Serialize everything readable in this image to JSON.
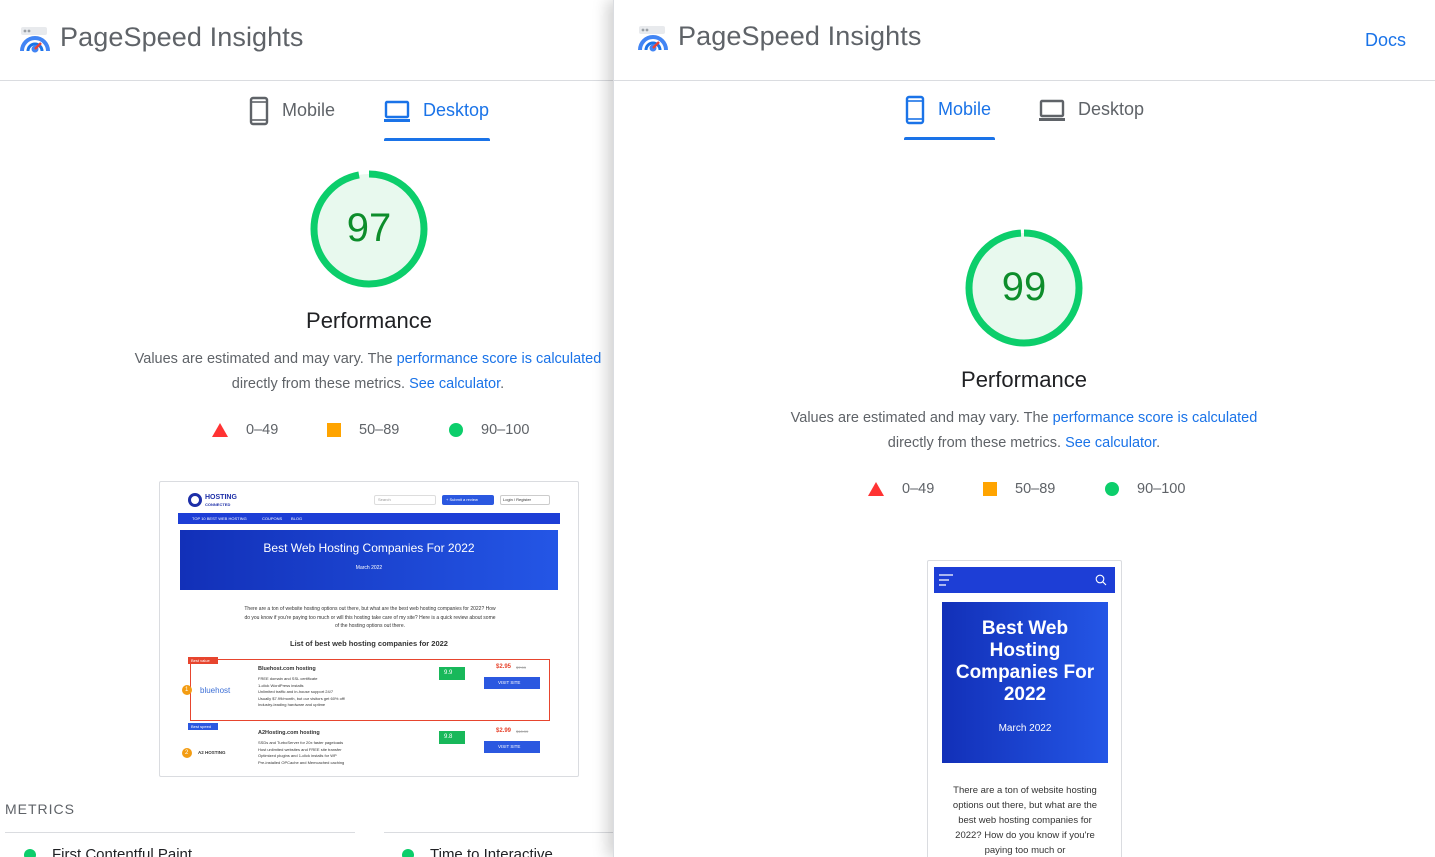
{
  "left": {
    "header": {
      "title": "PageSpeed Insights"
    },
    "tabs": [
      {
        "label": "Mobile",
        "active": false
      },
      {
        "label": "Desktop",
        "active": true
      }
    ],
    "score": {
      "value": "97",
      "fraction": 0.97
    },
    "category_title": "Performance",
    "description": {
      "text1": "Values are estimated and may vary. The ",
      "link1": "performance score is calculated",
      "text2": "directly from these metrics. ",
      "link2": "See calculator",
      "text3": "."
    },
    "legend": [
      {
        "range": "0–49",
        "shape": "triangle",
        "color": "#ff3333"
      },
      {
        "range": "50–89",
        "shape": "square",
        "color": "#ffa400"
      },
      {
        "range": "90–100",
        "shape": "circle",
        "color": "#0cce6b"
      }
    ],
    "screenshot": {
      "brand": "HOSTING",
      "brand_sub": "CONNECTED",
      "search_placeholder": "Search",
      "submit_btn": "+ Submit a review",
      "login_btn": "Login / Register",
      "nav": [
        "TOP 10 BEST WEB HOSTING",
        "COUPONS",
        "BLOG"
      ],
      "hero_title": "Best Web Hosting Companies For 2022",
      "hero_date": "March 2022",
      "intro": "There are a ton of website hosting options out there, but what are the best web hosting companies for 2022? How do you know if you're paying too much or will this hosting take care of my site? Here is a quick review about some of the hosting options out there.",
      "list_title": "List of best web hosting companies for 2022",
      "entries": [
        {
          "rank": "1",
          "badge": "Best value",
          "logo": "bluehost",
          "name": "Bluehost.com hosting",
          "rating": "9.9",
          "price": "$2.95",
          "old_price": "$7.99",
          "button": "VISIT SITE",
          "features": [
            "FREE domain and SSL certificate",
            "1-click WordPress installs",
            "Unlimited traffic and in-house support 24/7",
            "Usually $7.99/month, but our visitors get 60% off!",
            "Industry-leading hardware and uptime"
          ]
        },
        {
          "rank": "2",
          "badge": "Best speed",
          "logo": "A2 HOSTING",
          "name": "A2Hosting.com hosting",
          "rating": "9.8",
          "price": "$2.99",
          "old_price": "$10.99",
          "button": "VISIT SITE",
          "features": [
            "SSDs and TurboServer for 20x faster pageloads",
            "Host unlimited websites and FREE site transfer",
            "Optimized plugins and 1-click installs for WP",
            "Pre-installed OPCache and Memcached caching"
          ]
        }
      ]
    },
    "metrics": {
      "title": "METRICS",
      "items": [
        "First Contentful Paint",
        "Time to Interactive"
      ]
    }
  },
  "right": {
    "header": {
      "title": "PageSpeed Insights",
      "docs": "Docs"
    },
    "tabs": [
      {
        "label": "Mobile",
        "active": true
      },
      {
        "label": "Desktop",
        "active": false
      }
    ],
    "score": {
      "value": "99",
      "fraction": 0.99
    },
    "category_title": "Performance",
    "description": {
      "text1": "Values are estimated and may vary. The ",
      "link1": "performance score is calculated",
      "text2": "directly from these metrics. ",
      "link2": "See calculator",
      "text3": "."
    },
    "legend": [
      {
        "range": "0–49",
        "shape": "triangle",
        "color": "#ff3333"
      },
      {
        "range": "50–89",
        "shape": "square",
        "color": "#ffa400"
      },
      {
        "range": "90–100",
        "shape": "circle",
        "color": "#0cce6b"
      }
    ],
    "screenshot": {
      "hero_title": "Best Web Hosting Companies For 2022",
      "hero_date": "March 2022",
      "intro": "There are a ton of website hosting options out there, but what are the best web hosting companies for 2022? How do you know if you're paying too much or"
    }
  },
  "colors": {
    "accent": "#1a73e8",
    "pass": "#0cce6b",
    "pass_text": "#0d8d2b",
    "pass_fill": "#e8f9ee",
    "average": "#ffa400",
    "fail": "#ff3333",
    "hero_blue": "#1d3ed6"
  }
}
